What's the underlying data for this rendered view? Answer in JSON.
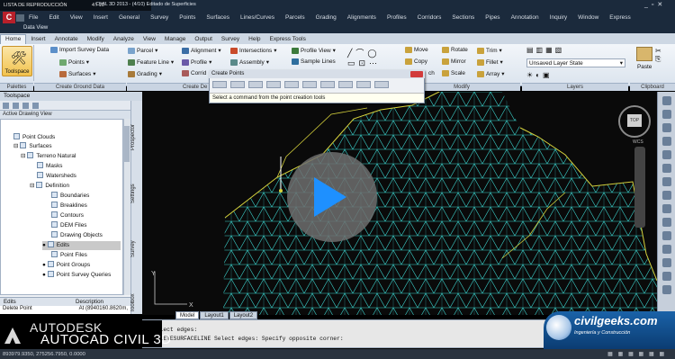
{
  "window": {
    "playlist": "LISTA DE REPRODUCCIÓN",
    "counter": "4 / 10",
    "title": "CIVIL 3D 2013 - (4/10) Editado de Superficies",
    "data_view": "Data View"
  },
  "menu": [
    "File",
    "Edit",
    "View",
    "Insert",
    "General",
    "Survey",
    "Points",
    "Surfaces",
    "Lines/Curves",
    "Parcels",
    "Grading",
    "Alignments",
    "Profiles",
    "Corridors",
    "Sections",
    "Pipes",
    "Annotation",
    "Inquiry",
    "Window",
    "Express"
  ],
  "ribbon_tabs": {
    "active": "Home",
    "tabs": [
      "Home",
      "Insert",
      "Annotate",
      "Modify",
      "Analyze",
      "View",
      "Manage",
      "Output",
      "Survey",
      "Help",
      "Express Tools"
    ]
  },
  "ribbon": {
    "toolspace": "Toolspace",
    "import_survey": "Import Survey Data",
    "points": "Points",
    "surfaces": "Surfaces",
    "parcel": "Parcel",
    "feature_line": "Feature Line",
    "grading": "Grading",
    "alignment": "Alignment",
    "profile": "Profile",
    "corridor": "Corrid",
    "intersections": "Intersections",
    "assembly": "Assembly",
    "profile_view": "Profile View",
    "sample_lines": "Sample Lines",
    "move": "Move",
    "copy": "Copy",
    "stretch": "ch",
    "rotate": "Rotate",
    "mirror": "Mirror",
    "scale": "Scale",
    "trim": "Trim",
    "fillet": "Fillet",
    "array": "Array",
    "layer_state": "Unsaved Layer State",
    "paste": "Paste",
    "panels": {
      "palettes": "Palettes",
      "create_ground": "Create Ground Data",
      "create_de": "Create De",
      "modify": "Modify",
      "layers": "Layers",
      "clipboard": "Clipboard"
    }
  },
  "create_points": {
    "title": "Create Points",
    "tooltip": "Select a command from the point creation tools"
  },
  "toolspace": {
    "header": "Toolspace",
    "view": "Active Drawing View",
    "tabs": [
      "Prospector",
      "Settings",
      "Survey",
      "Toolbox"
    ],
    "tree": [
      {
        "label": "Point Clouds",
        "level": 3
      },
      {
        "label": "Surfaces",
        "level": 2
      },
      {
        "label": "Terreno Natural",
        "level": 3
      },
      {
        "label": "Masks",
        "level": 4
      },
      {
        "label": "Watersheds",
        "level": 4
      },
      {
        "label": "Definition",
        "level": 4
      },
      {
        "label": "Boundaries",
        "level": 5
      },
      {
        "label": "Breaklines",
        "level": 5
      },
      {
        "label": "Contours",
        "level": 5
      },
      {
        "label": "DEM Files",
        "level": 5
      },
      {
        "label": "Drawing Objects",
        "level": 5
      },
      {
        "label": "Edits",
        "level": 5,
        "selected": true
      },
      {
        "label": "Point Files",
        "level": 5
      },
      {
        "label": "Point Groups",
        "level": 5
      },
      {
        "label": "Point Survey Queries",
        "level": 5
      }
    ],
    "props_headers": [
      "Edits",
      "Description"
    ],
    "props_row": {
      "name": "Delete Point",
      "desc": "At (8940160.8620m,"
    }
  },
  "layout_tabs": [
    "Model",
    "Layout1",
    "Layout2"
  ],
  "command": {
    "line1": "Select edges:",
    "line2": "DELETESURFACELINE Select edges: Specify opposite corner:"
  },
  "status": "893979.9350, 275256.7950, 0.0000",
  "viewcube": {
    "top": "TOP",
    "wcs": "WCS"
  },
  "branding": {
    "autodesk": "AUTODESK",
    "product": "AUTOCAD CIVIL 3D",
    "site": "civilgeeks.com",
    "site_sub": "Ingeniería y Construcción"
  },
  "colors": {
    "accent": "#1e90ff",
    "mesh": "#3fe6e0",
    "boundary": "#d6d23c"
  }
}
